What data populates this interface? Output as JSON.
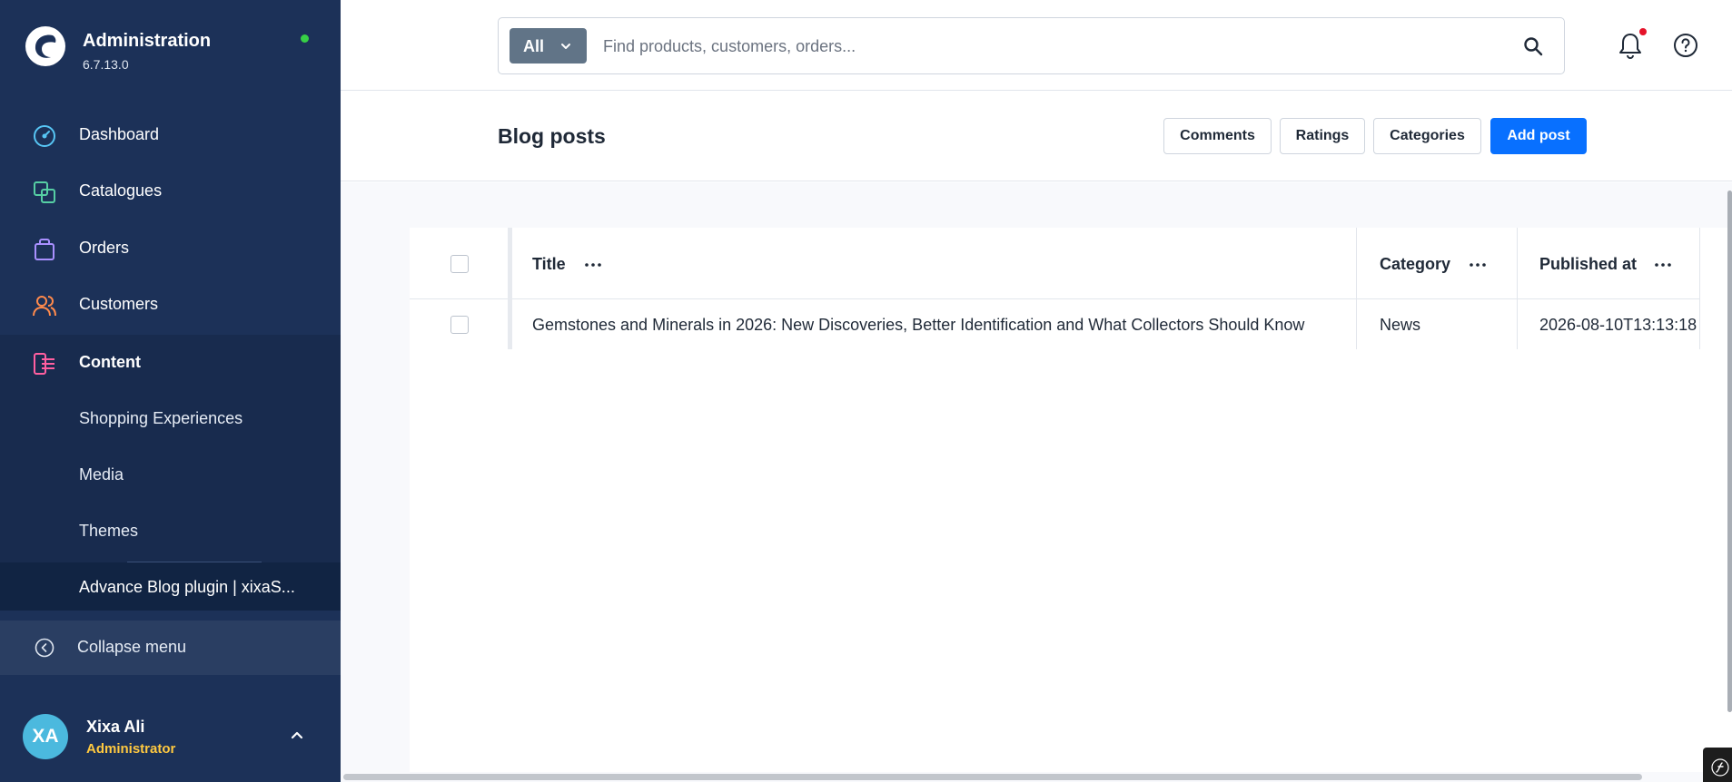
{
  "sidebar": {
    "brand_title": "Administration",
    "brand_version": "6.7.13.0",
    "items": [
      {
        "label": "Dashboard",
        "icon": "dashboard-icon",
        "color": "#57c6f5"
      },
      {
        "label": "Catalogues",
        "icon": "catalogues-icon",
        "color": "#56cfa4"
      },
      {
        "label": "Orders",
        "icon": "orders-icon",
        "color": "#a990ff"
      },
      {
        "label": "Customers",
        "icon": "customers-icon",
        "color": "#ff8a4c"
      },
      {
        "label": "Content",
        "icon": "content-icon",
        "color": "#ff5fa0"
      }
    ],
    "sub_items": [
      "Shopping Experiences",
      "Media",
      "Themes"
    ],
    "active_sub": "Advance Blog plugin | xixaS...",
    "collapse_label": "Collapse menu",
    "user": {
      "initials": "XA",
      "name": "Xixa Ali",
      "role": "Administrator"
    }
  },
  "header": {
    "search_type": "All",
    "search_placeholder": "Find products, customers, orders..."
  },
  "page": {
    "title": "Blog posts",
    "buttons": {
      "comments": "Comments",
      "ratings": "Ratings",
      "categories": "Categories",
      "add": "Add post"
    }
  },
  "grid": {
    "columns": [
      "Title",
      "Category",
      "Published at"
    ],
    "rows": [
      {
        "title": "Gemstones and Minerals in 2026: New Discoveries, Better Identification and What Collectors Should Know",
        "category": "News",
        "published": "2026-08-10T13:13:18"
      }
    ]
  },
  "colors": {
    "sidebar": "#1c3158",
    "primary": "#0870ff",
    "online": "#37d046",
    "role": "#ffc940"
  }
}
